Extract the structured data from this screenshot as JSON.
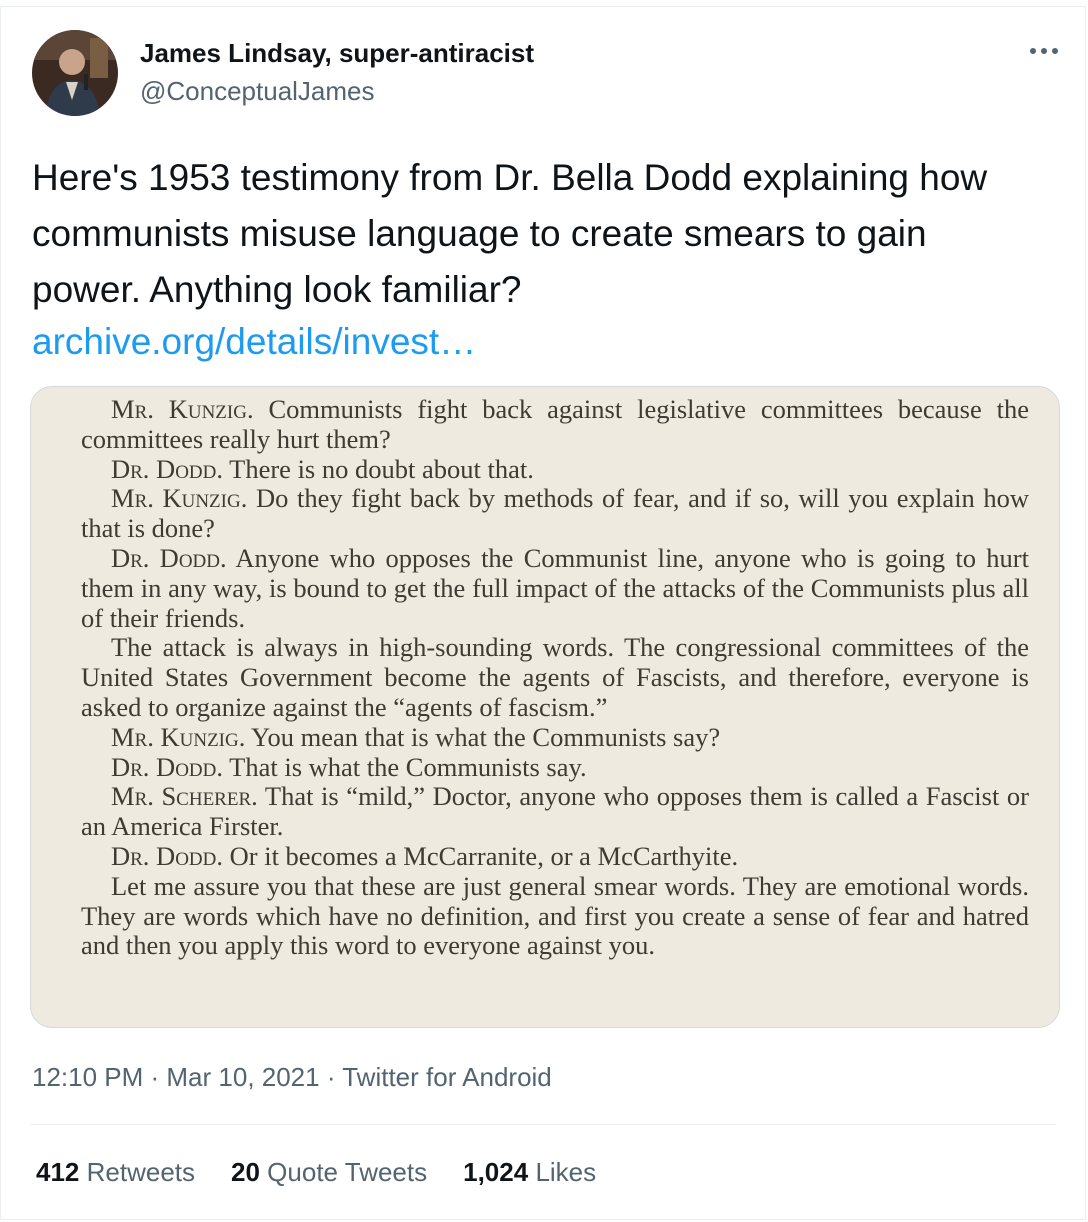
{
  "tweet": {
    "author_name": "James Lindsay, super-antiracist",
    "handle": "@ConceptualJames",
    "text": "Here's 1953 testimony from Dr. Bella Dodd explaining how communists misuse language to create smears to gain power. Anything look familiar?",
    "link": "archive.org/details/invest…",
    "timestamp": "12:10 PM · Mar 10, 2021 · Twitter for Android",
    "stats": {
      "retweets_count": "412",
      "retweets_label": "Retweets",
      "quotes_count": "20",
      "quotes_label": "Quote Tweets",
      "likes_count": "1,024",
      "likes_label": "Likes"
    }
  },
  "scan": {
    "p1_speaker": "Mr. Kunzig.",
    "p1_text": "Communists fight back against legislative committees because the committees really hurt them?",
    "p2_speaker": "Dr. Dodd.",
    "p2_text": "There is no doubt about that.",
    "p3_speaker": "Mr. Kunzig.",
    "p3_text": "Do they fight back by methods of fear, and if so, will you explain how that is done?",
    "p4_speaker": "Dr. Dodd.",
    "p4_text": "Anyone who opposes the Communist line, anyone who is going to hurt them in any way, is bound to get the full impact of the attacks of the Communists plus all of their friends.",
    "p5_text": "The attack is always in high-sounding words. The congressional committees of the United States Government become the agents of Fascists, and therefore, everyone is asked to organize against the “agents of fascism.”",
    "p6_speaker": "Mr. Kunzig.",
    "p6_text": "You mean that is what the Communists say?",
    "p7_speaker": "Dr. Dodd.",
    "p7_text": "That is what the Communists say.",
    "p8_speaker": "Mr. Scherer.",
    "p8_text": "That is “mild,” Doctor, anyone who opposes them is called a Fascist or an America Firster.",
    "p9_speaker": "Dr. Dodd.",
    "p9_text": "Or it becomes a McCarranite, or a McCarthyite.",
    "p10_text": "Let me assure you that these are just general smear words. They are emotional words. They are words which have no definition, and first you create a sense of fear and hatred and then you apply this word to everyone against you."
  },
  "icons": {
    "more": "more-horizontal-icon",
    "avatar": "profile-photo"
  },
  "colors": {
    "link": "#1d9bf0",
    "secondary_text": "#536471",
    "divider": "#ebeef0",
    "paper": "#efeadf"
  }
}
